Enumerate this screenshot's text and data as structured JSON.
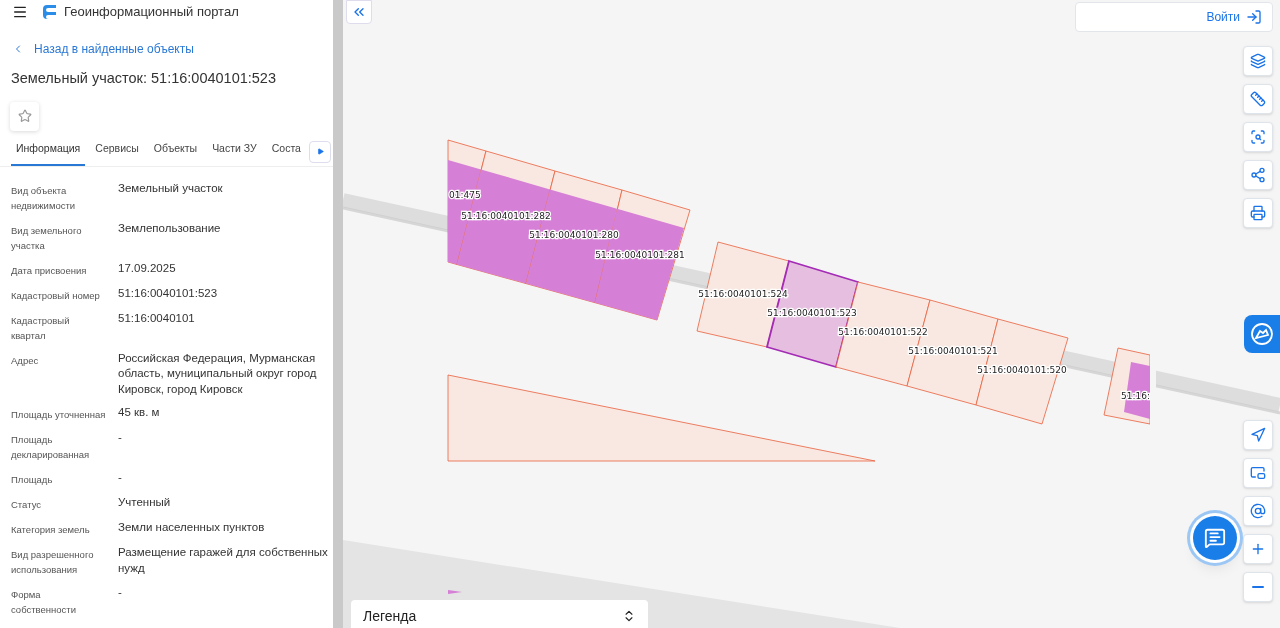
{
  "header": {
    "title": "Геоинформационный портал"
  },
  "back_link": "Назад в найденные объекты",
  "title": "Земельный участок: 51:16:0040101:523",
  "tabs": [
    {
      "label": "Информация",
      "selected": true
    },
    {
      "label": "Сервисы",
      "selected": false
    },
    {
      "label": "Объекты",
      "selected": false
    },
    {
      "label": "Части ЗУ",
      "selected": false
    },
    {
      "label": "Соста",
      "selected": false
    }
  ],
  "fields": [
    {
      "label": "Вид объекта недвижимости",
      "value": "Земельный участок"
    },
    {
      "label": "Вид земельного участка",
      "value": "Землепользование"
    },
    {
      "label": "Дата присвоения",
      "value": "17.09.2025"
    },
    {
      "label": "Кадастровый номер",
      "value": "51:16:0040101:523"
    },
    {
      "label": "Кадастровый квартал",
      "value": "51:16:0040101"
    },
    {
      "label": "Адрес",
      "value": "Российская Федерация, Мурманская область, муниципальный округ город Кировск, город Кировск"
    },
    {
      "label": "Площадь уточненная",
      "value": "45 кв. м"
    },
    {
      "label": "Площадь декларированная",
      "value": "-"
    },
    {
      "label": "Площадь",
      "value": "-"
    },
    {
      "label": "Статус",
      "value": "Учтенный"
    },
    {
      "label": "Категория земель",
      "value": "Земли населенных пунктов"
    },
    {
      "label": "Вид разрешенного использования",
      "value": "Размещение гаражей для собственных нужд"
    },
    {
      "label": "Форма собственности",
      "value": "-"
    }
  ],
  "map": {
    "login_button": "Войти",
    "legend": "Легенда",
    "parcels": [
      {
        "label": "01:475",
        "color": "#d67fd6",
        "selected": false
      },
      {
        "label": "51:16:0040101:282",
        "color": "#d67fd6",
        "selected": false
      },
      {
        "label": "51:16:0040101:280",
        "color": "#d67fd6",
        "selected": false
      },
      {
        "label": "51:16:0040101:281",
        "color": "#d67fd6",
        "selected": false
      },
      {
        "label": "51:16:0040101:524",
        "color": "#f9e8e1",
        "selected": false
      },
      {
        "label": "51:16:0040101:523",
        "color": "#e6bfe0",
        "selected": true
      },
      {
        "label": "51:16:0040101:522",
        "color": "#f9e8e1",
        "selected": false
      },
      {
        "label": "51:16:0040101:521",
        "color": "#f9e8e1",
        "selected": false
      },
      {
        "label": "51:16:0040101:520",
        "color": "#f9e8e1",
        "selected": false
      },
      {
        "label": "51:16:",
        "color": "#d67fd6",
        "selected": false
      }
    ]
  }
}
